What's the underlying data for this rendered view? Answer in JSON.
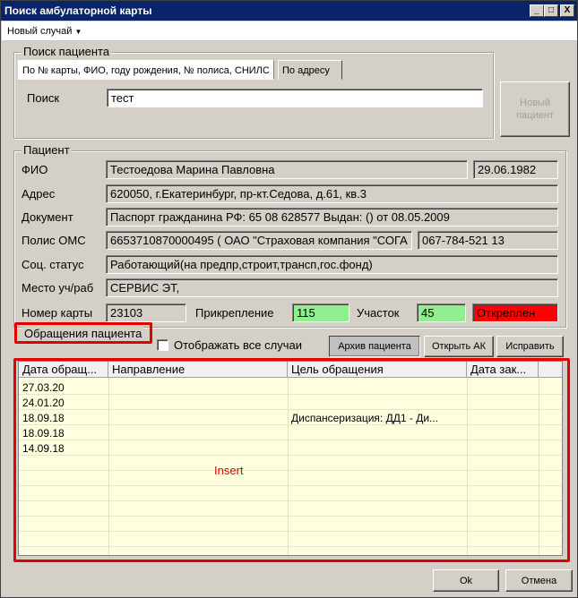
{
  "window": {
    "title": "Поиск амбулаторной карты",
    "controls": [
      "_",
      "□",
      "X"
    ]
  },
  "menu": {
    "new_case": "Новый случай"
  },
  "search": {
    "group_title": "Поиск пациента",
    "tab_main": "По № карты, ФИО, году рождения, № полиса, СНИЛС",
    "tab_address": "По адресу",
    "search_label": "Поиск",
    "search_value": "тест",
    "new_patient_button": "Новый пациент"
  },
  "patient": {
    "group_title": "Пациент",
    "fio_label": "ФИО",
    "fio_value": "Тестоедова Марина Павловна",
    "birth_date": "29.06.1982",
    "address_label": "Адрес",
    "address_value": "620050, г.Екатеринбург, пр-кт.Седова, д.61, кв.3",
    "document_label": "Документ",
    "document_value": "Паспорт гражданина РФ: 65 08 628577 Выдан: () от 08.05.2009",
    "oms_label": "Полис ОМС",
    "oms_value": "6653710870000495 ( ОАО \"Страховая компания \"СОГА",
    "snils_value": "067-784-521 13",
    "social_label": "Соц. статус",
    "social_value": "Работающий(на предпр,строит,трансп,гос.фонд)",
    "workplace_label": "Место уч/раб",
    "workplace_value": "СЕРВИС ЭТ,",
    "card_label": "Номер карты",
    "card_value": "23103",
    "attach_label": "Прикрепление",
    "attach_value": "115",
    "district_label": "Участок",
    "district_value": "45",
    "status_value": "Откреплен"
  },
  "visits": {
    "group_title": "Обращения пациента",
    "show_all_label": "Отображать все случаи",
    "archive_button": "Архив пациента",
    "open_ak_button": "Открыть АК",
    "fix_button": "Исправить",
    "columns": [
      "Дата обращ...",
      "Направление",
      "Цель обращения",
      "Дата зак..."
    ],
    "rows": [
      [
        "27.03.20",
        "",
        "",
        ""
      ],
      [
        "24.01.20",
        "",
        "",
        ""
      ],
      [
        "18.09.18",
        "",
        "Диспансеризация: ДД1 - Ди...",
        ""
      ],
      [
        "18.09.18",
        "",
        "",
        ""
      ],
      [
        "14.09.18",
        "",
        "",
        ""
      ]
    ],
    "annotation": "Insert"
  },
  "footer": {
    "ok_button": "Ok",
    "cancel_button": "Отмена"
  },
  "colors": {
    "titlebar": "#0a246a",
    "grid_bg": "#ffffe0",
    "green": "#90ee90",
    "red": "#ff0000",
    "annotation": "#e00000"
  }
}
